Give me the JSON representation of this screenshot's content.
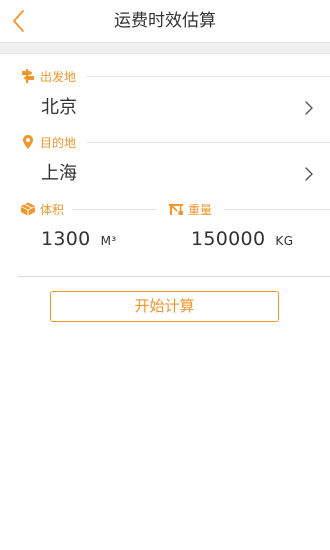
{
  "header": {
    "title": "运费时效估算"
  },
  "origin": {
    "label": "出发地",
    "value": "北京"
  },
  "destination": {
    "label": "目的地",
    "value": "上海"
  },
  "volume": {
    "label": "体积",
    "value": "1300",
    "unit": "M³"
  },
  "weight": {
    "label": "重量",
    "value": "150000",
    "unit": "KG"
  },
  "actions": {
    "start_label": "开始计算"
  },
  "colors": {
    "accent": "#f0962a",
    "text": "#333333",
    "separator": "#f0f0f0"
  },
  "icons": {
    "back": "chevron-left-icon",
    "origin": "signpost-icon",
    "destination": "location-pin-icon",
    "volume": "box-icon",
    "weight": "crane-icon",
    "row_arrow": "chevron-right-icon"
  }
}
